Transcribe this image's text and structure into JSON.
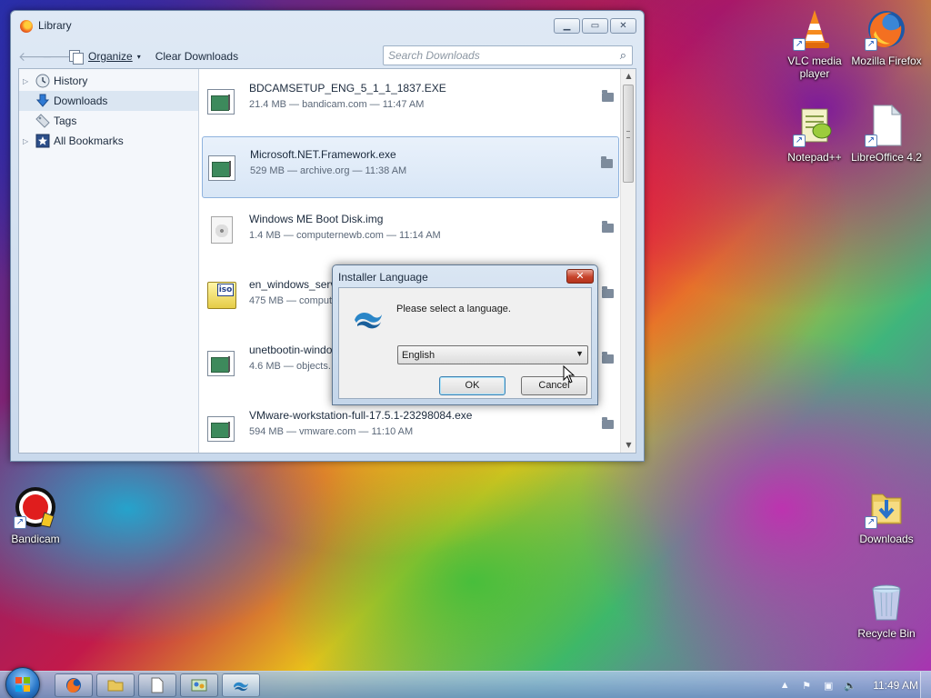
{
  "desktop": {
    "icons": {
      "vlc": "VLC media player",
      "firefox": "Mozilla Firefox",
      "notepadpp": "Notepad++",
      "libreoffice": "LibreOffice 4.2",
      "bandicam": "Bandicam",
      "downloads": "Downloads",
      "recycle_bin": "Recycle Bin"
    }
  },
  "library": {
    "title": "Library",
    "toolbar": {
      "organize": "Organize",
      "clear_downloads": "Clear Downloads",
      "search_placeholder": "Search Downloads"
    },
    "sidebar": [
      "History",
      "Downloads",
      "Tags",
      "All Bookmarks"
    ],
    "downloads": [
      {
        "name": "BDCAMSETUP_ENG_5_1_1_1837.EXE",
        "meta": "21.4 MB — bandicam.com — 11:47 AM"
      },
      {
        "name": "Microsoft.NET.Framework.exe",
        "meta": "529 MB — archive.org — 11:38 AM"
      },
      {
        "name": "Windows ME Boot Disk.img",
        "meta": "1.4 MB — computernewb.com — 11:14 AM"
      },
      {
        "name": "en_windows_server",
        "meta": "475 MB — comput"
      },
      {
        "name": "unetbootin-windo",
        "meta": "4.6 MB — objects."
      },
      {
        "name": "VMware-workstation-full-17.5.1-23298084.exe",
        "meta": "594 MB — vmware.com — 11:10 AM"
      }
    ]
  },
  "dialog": {
    "title": "Installer Language",
    "message": "Please select a language.",
    "selected_language": "English",
    "ok": "OK",
    "cancel": "Cancel"
  },
  "taskbar": {
    "clock": "11:49 AM"
  },
  "colors": {
    "selection_border": "#8fb3de",
    "dialog_close": "#c7432b"
  }
}
